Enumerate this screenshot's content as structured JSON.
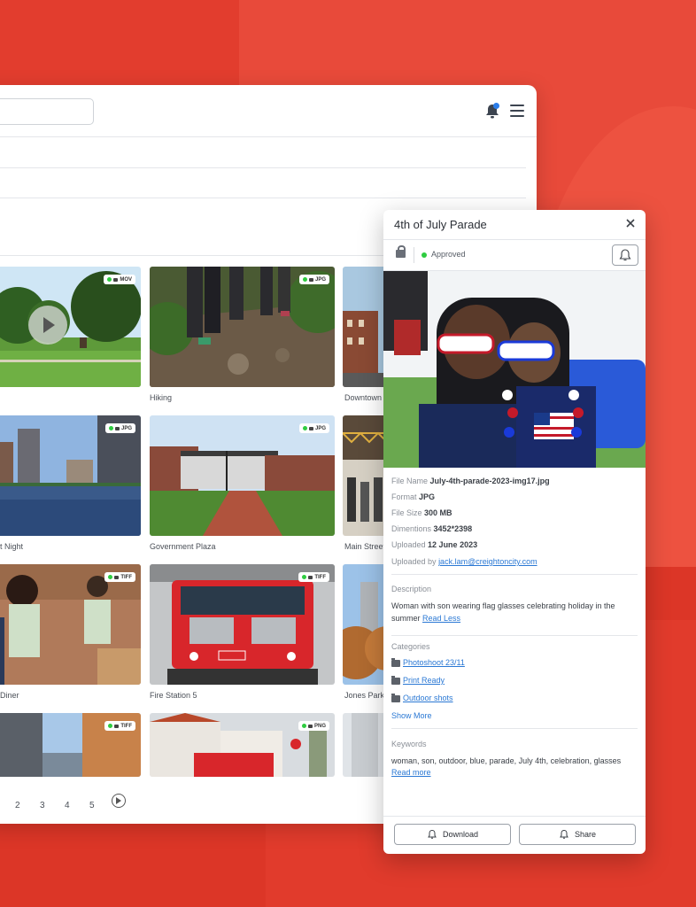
{
  "grid": {
    "items": [
      {
        "caption": "",
        "format": "MOV"
      },
      {
        "caption": "Hiking",
        "format": "JPG"
      },
      {
        "caption": "Downtown",
        "format": ""
      },
      {
        "caption": "t Night",
        "format": "JPG"
      },
      {
        "caption": "Government Plaza",
        "format": "JPG"
      },
      {
        "caption": "Main Street",
        "format": ""
      },
      {
        "caption": "Diner",
        "format": "TIFF"
      },
      {
        "caption": "Fire Station 5",
        "format": "TIFF"
      },
      {
        "caption": "Jones Park",
        "format": ""
      },
      {
        "caption": "",
        "format": "TIFF"
      },
      {
        "caption": "",
        "format": "PNG"
      }
    ]
  },
  "pagination": {
    "pages": [
      "2",
      "3",
      "4",
      "5"
    ]
  },
  "panel": {
    "title": "4th of July Parade",
    "status": "Approved",
    "file_name_label": "File Name",
    "file_name": "July-4th-parade-2023-img17.jpg",
    "format_label": "Format",
    "format": "JPG",
    "file_size_label": "File Size",
    "file_size": "300 MB",
    "dimensions_label": "Dimentions",
    "dimensions": "3452*2398",
    "uploaded_label": "Uploaded",
    "uploaded": "12 June 2023",
    "uploaded_by_label": "Uploaded by",
    "uploaded_by": "jack.lam@creightoncity.com",
    "description_label": "Description",
    "description": "Woman with son wearing flag glasses celebrating holiday in the summer",
    "read_less": "Read Less",
    "categories_label": "Categories",
    "categories": [
      "Photoshoot 23/11",
      "Print Ready",
      "Outdoor shots"
    ],
    "show_more": "Show More",
    "keywords_label": "Keywords",
    "keywords": "woman, son, outdoor, blue, parade, July 4th, celebration, glasses",
    "read_more": "Read more",
    "download": "Download",
    "share": "Share"
  },
  "colors": {
    "background": "#e13a2b",
    "accent": "#2a78d4",
    "status_green": "#2ecc40"
  }
}
